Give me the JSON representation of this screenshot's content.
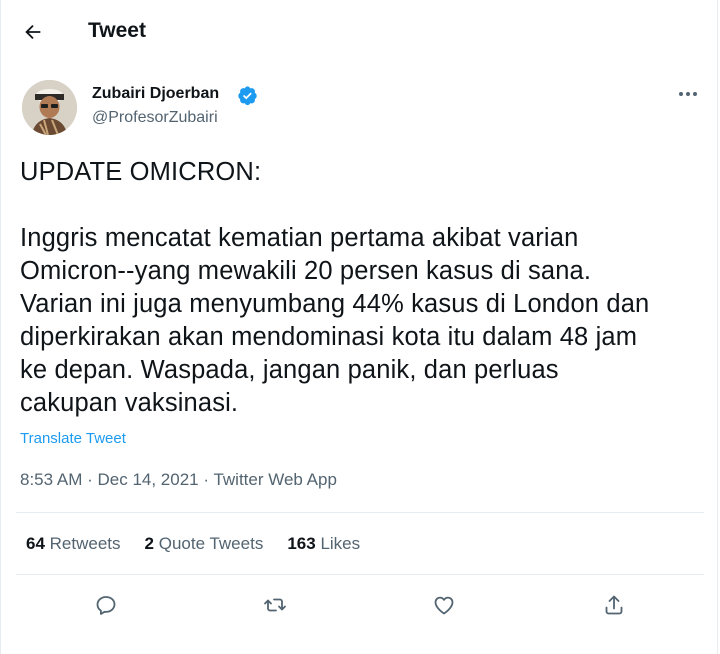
{
  "header": {
    "title": "Tweet",
    "back_icon": "arrow-left-icon"
  },
  "author": {
    "name": "Zubairi Djoerban",
    "handle": "@ProfesorZubairi",
    "verified_icon": "verified-badge-icon",
    "verified_color": "#1d9bf0"
  },
  "tweet": {
    "text": "UPDATE OMICRON:\n\nInggris mencatat kematian pertama akibat varian\nOmicron--yang mewakili 20 persen kasus di sana.\nVarian ini juga menyumbang 44% kasus di London dan\ndiperkirakan akan mendominasi kota itu dalam 48 jam\nke depan. Waspada, jangan panik, dan perluas\ncakupan vaksinasi.",
    "translate_label": "Translate Tweet",
    "time": "8:53 AM",
    "date": "Dec 14, 2021",
    "source": "Twitter Web App",
    "separator": "·"
  },
  "stats": {
    "retweets_count": "64",
    "retweets_label": "Retweets",
    "quotes_count": "2",
    "quotes_label": "Quote Tweets",
    "likes_count": "163",
    "likes_label": "Likes"
  },
  "actions": {
    "reply_icon": "reply-icon",
    "retweet_icon": "retweet-icon",
    "like_icon": "heart-icon",
    "share_icon": "share-icon"
  },
  "colors": {
    "text": "#0f1419",
    "secondary": "#536471",
    "accent": "#1d9bf0",
    "border": "#e6ecf0"
  }
}
